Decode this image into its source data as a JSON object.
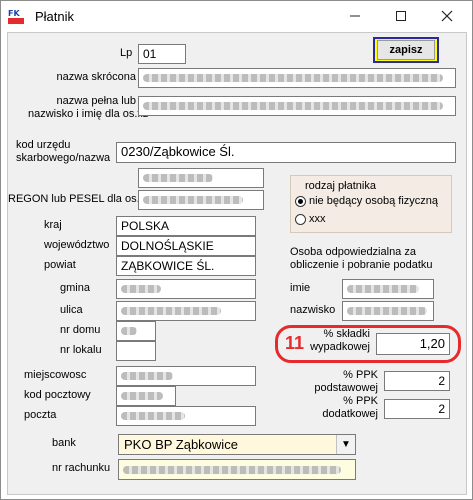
{
  "window": {
    "title": "Płatnik",
    "icon_label": "FK",
    "controls": [
      "minimize-icon",
      "maximize-icon",
      "close-icon"
    ]
  },
  "toolbar": {
    "save_label": "zapisz"
  },
  "form": {
    "lp": {
      "label": "Lp",
      "value": "01"
    },
    "nazwa_skrocona": {
      "label": "nazwa skrócona"
    },
    "nazwa_pelna": {
      "label_line1": "nazwa pełna lub",
      "label_line2": "nazwisko i imię dla os.fiz"
    },
    "kod_urzedu": {
      "label_line1": "kod urzędu",
      "label_line2": "skarbowego/nazwa",
      "value": "0230/Ząbkowice Śl."
    },
    "nip": {
      "label": "NIP"
    },
    "regon": {
      "label": "REGON lub PESEL dla os.fiz."
    },
    "kraj": {
      "label": "kraj",
      "value": "POLSKA"
    },
    "wojewodztwo": {
      "label": "województwo",
      "value": "DOLNOŚLĄSKIE"
    },
    "powiat": {
      "label": "powiat",
      "value": "ZĄBKOWICE ŚL."
    },
    "gmina": {
      "label": "gmina"
    },
    "ulica": {
      "label": "ulica"
    },
    "nr_domu": {
      "label": "nr domu"
    },
    "nr_lokalu": {
      "label": "nr lokalu"
    },
    "miejscowosc": {
      "label": "miejscowosc"
    },
    "kod_pocztowy": {
      "label": "kod pocztowy"
    },
    "poczta": {
      "label": "poczta"
    },
    "bank": {
      "label": "bank",
      "value": "PKO BP Ząbkowice"
    },
    "nr_rachunku": {
      "label": "nr rachunku"
    }
  },
  "rodzaj": {
    "title": "rodzaj płatnika",
    "options": [
      {
        "label": "nie będący osobą fizyczną",
        "selected": true
      },
      {
        "label": "xxx",
        "selected": false
      }
    ]
  },
  "osoba": {
    "title_line1": "Osoba odpowiedzialna za",
    "title_line2": "obliczenie i pobranie podatku",
    "imie_label": "imie",
    "nazwisko_label": "nazwisko"
  },
  "skladki": {
    "annotation": "11",
    "wypadkowa_label_line1": "% składki",
    "wypadkowa_label_line2": "wypadkowej",
    "wypadkowa_value": "1,20",
    "ppk_podst_label_line1": "% PPK",
    "ppk_podst_label_line2": "podstawowej",
    "ppk_podst_value": "2",
    "ppk_dod_label_line1": "% PPK",
    "ppk_dod_label_line2": "dodatkowej",
    "ppk_dod_value": "2"
  },
  "colors": {
    "highlight": "#e52b2b",
    "save_button": "#ffff00",
    "save_border": "#2a2a9a",
    "group_bg": "#f4ece4"
  }
}
